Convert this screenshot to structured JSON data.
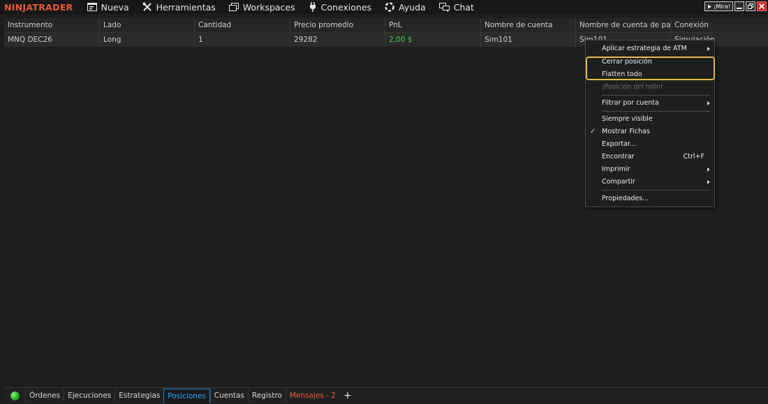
{
  "app": {
    "logo": "NINJATRADER"
  },
  "menu": [
    {
      "label": "Nueva",
      "icon": "new-window-icon"
    },
    {
      "label": "Herramientas",
      "icon": "tools-icon"
    },
    {
      "label": "Workspaces",
      "icon": "workspaces-icon"
    },
    {
      "label": "Conexiones",
      "icon": "plug-icon"
    },
    {
      "label": "Ayuda",
      "icon": "help-icon"
    },
    {
      "label": "Chat",
      "icon": "chat-icon"
    }
  ],
  "window": {
    "mira_label": "¡Mira!"
  },
  "grid": {
    "columns": [
      "Instrumento",
      "Lado",
      "Cantidad",
      "Precio promedio",
      "PnL",
      "Nombre de cuenta",
      "Nombre de cuenta de pantall",
      "Conexión"
    ],
    "rows": [
      [
        "MNQ DEC26",
        "Long",
        "1",
        "29282",
        "2,00 $",
        "Sim101",
        "Sim101",
        "Simulación"
      ]
    ]
  },
  "context_menu": {
    "items": [
      {
        "label": "Aplicar estrategia de ATM",
        "submenu": true
      },
      {
        "label": "Cerrar posición"
      },
      {
        "label": "Flatten todo"
      },
      {
        "label": "¡Posición del rollo!",
        "disabled": true
      },
      {
        "label": "Filtrar por cuenta",
        "submenu": true
      },
      {
        "label": "Siempre visible"
      },
      {
        "label": "Mostrar Fichas",
        "checked": true,
        "check_glyph": "✓"
      },
      {
        "label": "Exportar..."
      },
      {
        "label": "Encontrar",
        "shortcut": "Ctrl+F"
      },
      {
        "label": "Imprimir",
        "submenu": true
      },
      {
        "label": "Compartir",
        "submenu": true
      },
      {
        "label": "Propiedades..."
      }
    ]
  },
  "tabs": [
    {
      "label": "Órdenes"
    },
    {
      "label": "Ejecuciones"
    },
    {
      "label": "Estrategias"
    },
    {
      "label": "Posiciones",
      "active": true
    },
    {
      "label": "Cuentas"
    },
    {
      "label": "Registro"
    },
    {
      "label": "Mensajes - 2",
      "alert": true
    }
  ],
  "tab_add_label": "+",
  "colors": {
    "accent": "#2aa6ff",
    "brand": "#e65a3a",
    "positive": "#4bc94b",
    "highlight": "#e8b84a"
  }
}
